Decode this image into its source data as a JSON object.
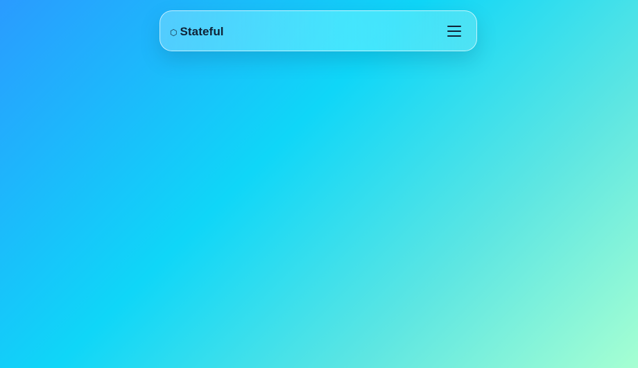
{
  "navbar": {
    "brand": {
      "icon": "hexagon-icon",
      "icon_glyph": "⬡",
      "name": "Stateful"
    },
    "menu_button": {
      "icon": "hamburger-menu-icon"
    }
  },
  "colors": {
    "background_gradient": [
      "#2a9bff",
      "#0fd6f8",
      "#5ee6e2",
      "#a6ffd2"
    ],
    "text": "#0f2236"
  }
}
